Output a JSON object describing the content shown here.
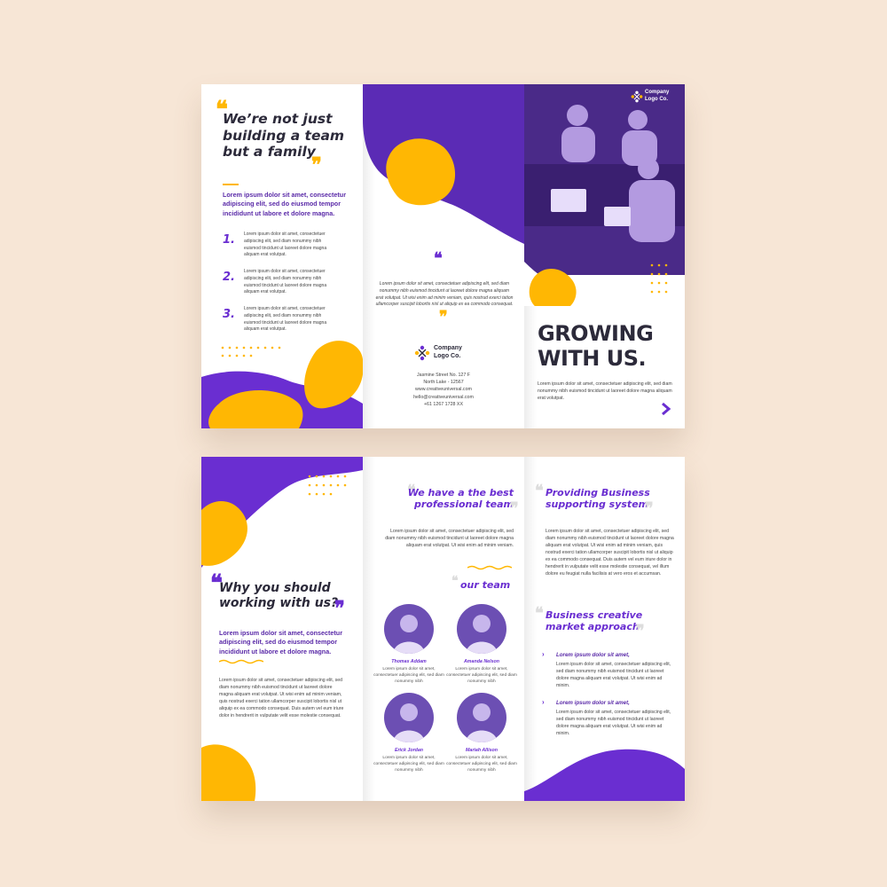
{
  "colors": {
    "purple": "#6a2ed1",
    "yellow": "#ffb703",
    "dark": "#2c2a3a",
    "background": "#f7e6d6"
  },
  "outside": {
    "left": {
      "title": "We’re not just building a team but a family",
      "lead": "Lorem ipsum dolor sit amet, consectetur adipiscing elit, sed do eiusmod tempor incididunt ut labore et dolore magna.",
      "items": [
        {
          "number": "1.",
          "text": "Lorem ipsum dolor sit amet, consectetuer adipiscing elit, sed diam nonummy nibh euismod tincidunt ut laoreet dolore magna aliquam erat volutpat."
        },
        {
          "number": "2.",
          "text": "Lorem ipsum dolor sit amet, consectetuer adipiscing elit, sed diam nonummy nibh euismod tincidunt ut laoreet dolore magna aliquam erat volutpat."
        },
        {
          "number": "3.",
          "text": "Lorem ipsum dolor sit amet, consectetuer adipiscing elit, sed diam nonummy nibh euismod tincidunt ut laoreet dolore magna aliquam erat volutpat."
        }
      ]
    },
    "middle": {
      "quote": "Lorem ipsum dolor sit amet, consectetuer adipiscing elit, sed diam nonummy nibh euismod tincidunt ut laoreet dolore magna aliquam erat volutpat. Ut wisi enim ad minim veniam, quis nostrud exerci tation ullamcorper suscipit lobortis nisl ut aliquip ex ea commodo consequat.",
      "logo_line1": "Company",
      "logo_line2": "Logo Co.",
      "address": [
        "Jasmine Street No. 127 F",
        "North Lake - 12567",
        "www.creativeuniversal.com",
        "hello@creativeuniversal.com",
        "+61 1267 1728 XX"
      ]
    },
    "right": {
      "logo_line1": "Company",
      "logo_line2": "Logo Co.",
      "headline_line1": "GROWING",
      "headline_line2": "WITH US.",
      "body": "Lorem ipsum dolor sit amet, consectetuer adipiscing elit, sed diam nonummy nibh euismod tincidunt ut laoreet dolore magna aliquam erat volutpat.",
      "arrow": "chevron-right-icon"
    }
  },
  "inside": {
    "left": {
      "title": "Why you should working with us?",
      "lead": "Lorem ipsum dolor sit amet, consectetur adipiscing elit, sed do eiusmod tempor incididunt ut labore et dolore magna.",
      "body": "Lorem ipsum dolor sit amet, consectetuer adipiscing elit, sed diam nonummy nibh euismod tincidunt ut laoreet dolore magna aliquam erat volutpat. Ut wisi enim ad minim veniam, quis nostrud exerci tation ullamcorper suscipit lobortis nisl ut aliquip ex ea commodo consequat. Duis autem vel eum iriure dolor in hendrerit in vulputate velit esse molestie consequat."
    },
    "middle": {
      "title": "We have a the best professional team",
      "body": "Lorem ipsum dolor sit amet, consectetuer adipiscing elit, sed diam nonummy nibh euismod tincidunt ut laoreet dolore magna aliquam erat volutpat. Ut wisi enim ad minim veniam.",
      "team_heading": "our team",
      "members": [
        {
          "name": "Thomas Addam",
          "text": "Lorem ipsum dolor sit amet, consectetuer adipiscing elit, sed diam nonummy nibh"
        },
        {
          "name": "Amanda Nelson",
          "text": "Lorem ipsum dolor sit amet, consectetuer adipiscing elit, sed diam nonummy nibh"
        },
        {
          "name": "Erick Jordan",
          "text": "Lorem ipsum dolor sit amet, consectetuer adipiscing elit, sed diam nonummy nibh"
        },
        {
          "name": "Mariah Allison",
          "text": "Lorem ipsum dolor sit amet, consectetuer adipiscing elit, sed diam nonummy nibh"
        }
      ]
    },
    "right": {
      "title1": "Providing Business supporting system",
      "body1": "Lorem ipsum dolor sit amet, consectetuer adipiscing elit, sed diam nonummy nibh euismod tincidunt ut laoreet dolore magna aliquam erat volutpat. Ut wisi enim ad minim veniam, quis nostrud exerci tation ullamcorper suscipit lobortis nisl ut aliquip ex ea commodo consequat. Duis autem vel eum iriure dolor in hendrerit in vulputate velit esse molestie consequat, vel illum dolore eu feugiat nulla facilisis at vero eros et accumsan.",
      "title2": "Business creative market approach",
      "points": [
        {
          "heading": "Lorem ipsum dolor sit amet,",
          "text": "Lorem ipsum dolor sit amet, consectetuer adipiscing elit, sed diam nonummy nibh euismod tincidunt ut laoreet dolore magna aliquam erat volutpat. Ut wisi enim ad minim."
        },
        {
          "heading": "Lorem ipsum dolor sit amet,",
          "text": "Lorem ipsum dolor sit amet, consectetuer adipiscing elit, sed diam nonummy nibh euismod tincidunt ut laoreet dolore magna aliquam erat volutpat. Ut wisi enim ad minim."
        }
      ]
    }
  }
}
